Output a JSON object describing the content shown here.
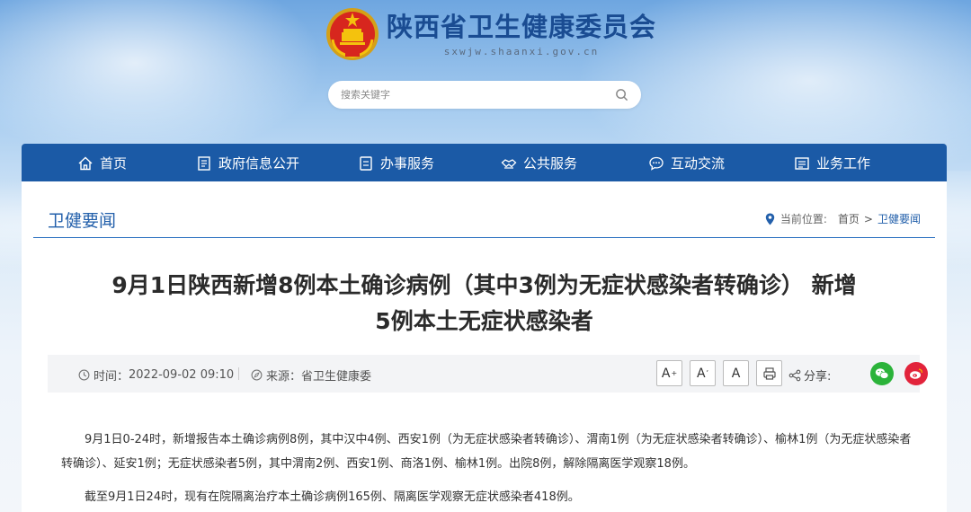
{
  "header": {
    "site_name": "陕西省卫生健康委员会",
    "site_domain": "sxwjw.shaanxi.gov.cn",
    "search_placeholder": "搜索关键字"
  },
  "nav": {
    "items": [
      {
        "label": "首页",
        "icon": "home-icon"
      },
      {
        "label": "政府信息公开",
        "icon": "document-list-icon"
      },
      {
        "label": "办事服务",
        "icon": "form-icon"
      },
      {
        "label": "公共服务",
        "icon": "handshake-icon"
      },
      {
        "label": "互动交流",
        "icon": "chat-icon"
      },
      {
        "label": "业务工作",
        "icon": "briefcase-list-icon"
      }
    ]
  },
  "section": {
    "title": "卫健要闻",
    "breadcrumb_label": "当前位置:",
    "breadcrumb": [
      "首页",
      "卫健要闻"
    ],
    "breadcrumb_separator": ">"
  },
  "article": {
    "title_line1": "9月1日陕西新增8例本土确诊病例（其中3例为无症状感染者转确诊） 新增",
    "title_line2": "5例本土无症状感染者",
    "time_label": "时间：",
    "time": "2022-09-02 09:10",
    "source_label": "来源：",
    "source": "省卫生健康委",
    "font_buttons": [
      "A+",
      "A",
      "A-"
    ],
    "share_label": "分享:",
    "paragraphs": [
      "9月1日0-24时，新增报告本土确诊病例8例，其中汉中4例、西安1例（为无症状感染者转确诊）、渭南1例（为无症状感染者转确诊）、榆林1例（为无症状感染者转确诊）、延安1例；无症状感染者5例，其中渭南2例、西安1例、商洛1例、榆林1例。出院8例，解除隔离医学观察18例。",
      "截至9月1日24时，现有在院隔离治疗本土确诊病例165例、隔离医学观察无症状感染者418例。"
    ]
  },
  "colors": {
    "nav_bg": "#1b5aa6",
    "title_blue": "#1a4c92",
    "wechat": "#2bb33a",
    "weibo": "#e2233b"
  }
}
